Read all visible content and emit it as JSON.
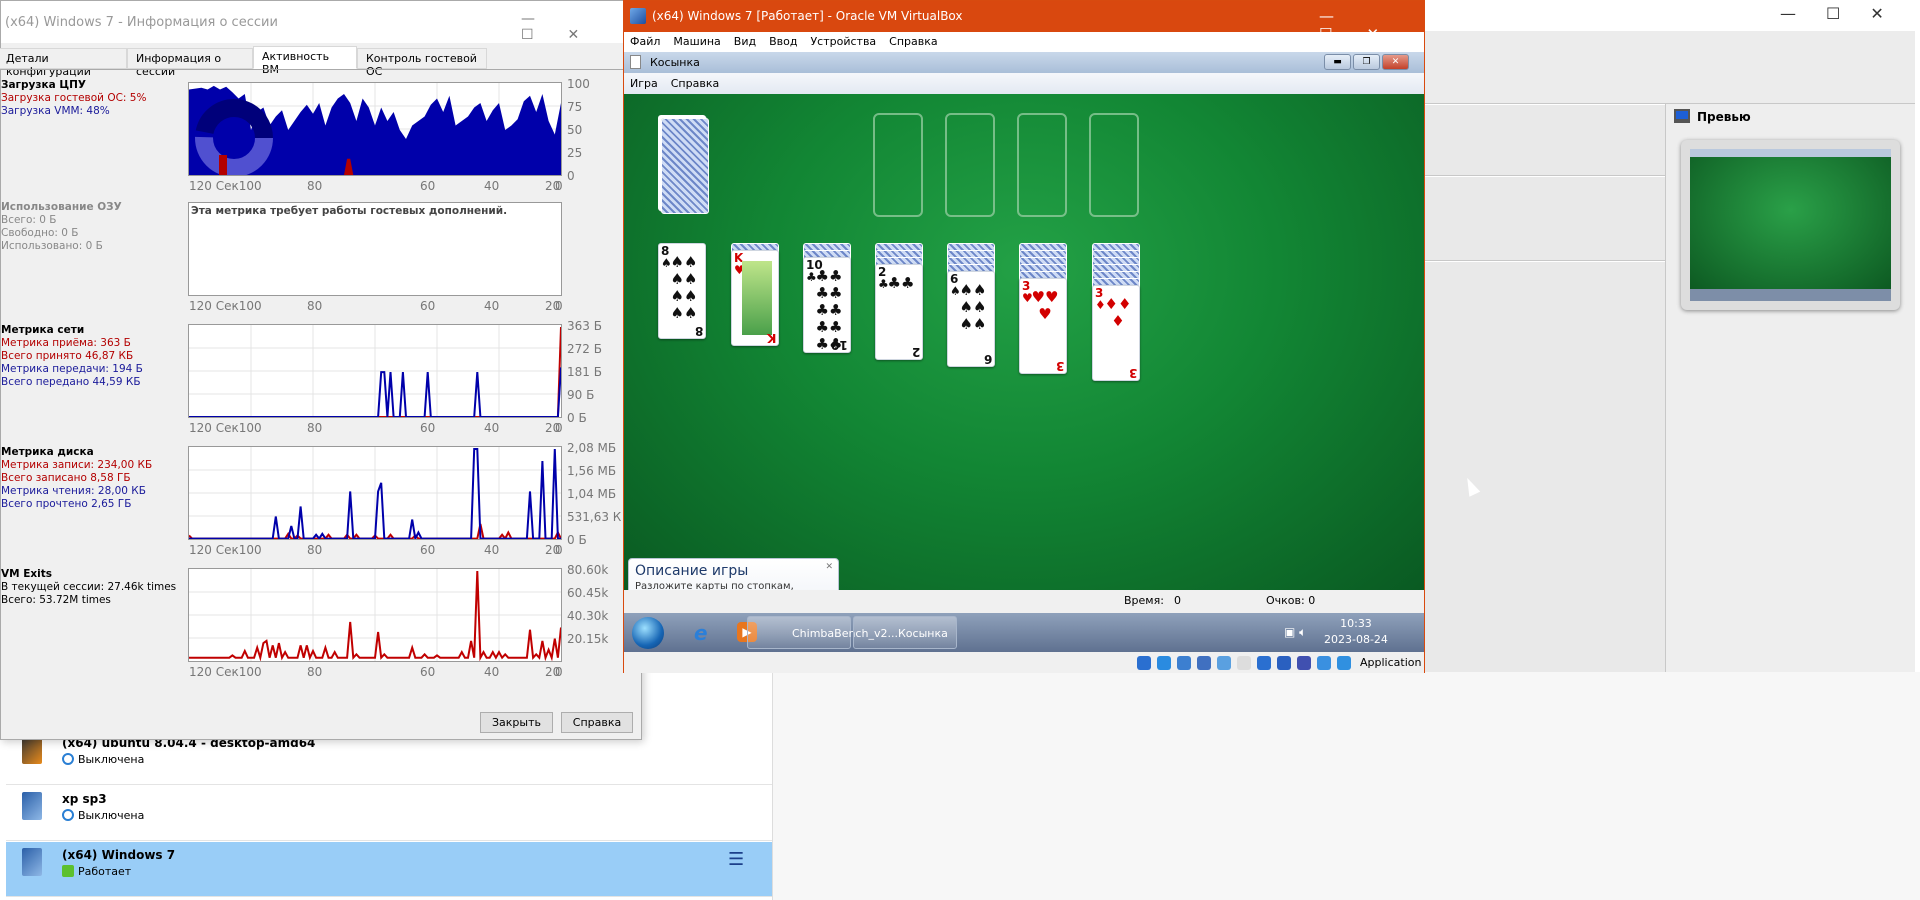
{
  "session_window": {
    "title": "(x64) Windows 7 - Информация о сессии",
    "tabs": [
      {
        "label": "Детали конфигурации",
        "active": false
      },
      {
        "label": "Информация о сессии",
        "active": false
      },
      {
        "label": "Активность ВМ",
        "active": true
      },
      {
        "label": "Контроль гостевой ОС",
        "active": false
      }
    ],
    "x_ticks": [
      "120 Сек100",
      "80",
      "60",
      "40",
      "20",
      "0"
    ],
    "cpu": {
      "title": "Загрузка ЦПУ",
      "guest": "Загрузка гостевой ОС: 5%",
      "vmm": "Загрузка VMM: 48%",
      "y_ticks": [
        "100",
        "75",
        "50",
        "25",
        "0"
      ],
      "ymax": 100,
      "vmm_series_every_2s_from_120": [
        95,
        96,
        97,
        95,
        99,
        95,
        98,
        92,
        85,
        90,
        50,
        70,
        75,
        55,
        65,
        72,
        50,
        60,
        70,
        78,
        68,
        80,
        55,
        75,
        85,
        90,
        80,
        60,
        85,
        75,
        55,
        75,
        60,
        70,
        50,
        40,
        55,
        60,
        65,
        78,
        85,
        70,
        88,
        55,
        60,
        65,
        75,
        80,
        60,
        72,
        80,
        50,
        55,
        62,
        82,
        88,
        70,
        90,
        60,
        45,
        80
      ],
      "guest_spikes": [
        [
          69,
          18
        ],
        [
          68,
          18
        ]
      ]
    },
    "ram": {
      "title": "Использование ОЗУ",
      "total": "Всего: 0 Б",
      "free": "Свободно: 0 Б",
      "used": "Использовано: 0 Б",
      "notice": "Эта метрика требует работы гостевых дополнений."
    },
    "net": {
      "title": "Метрика сети",
      "rx": "Метрика приёма: 363 Б",
      "rx_total": "Всего принято 46,87 КБ",
      "tx": "Метрика передачи: 194 Б",
      "tx_total": "Всего передано 44,59 КБ",
      "y_ticks": [
        "363 Б",
        "272 Б",
        "181 Б",
        "90 Б",
        "0 Б"
      ],
      "ymax": 363,
      "rx_spikes": [
        [
          0,
          363
        ]
      ],
      "tx_spikes": [
        [
          58,
          181
        ],
        [
          57,
          181
        ],
        [
          55,
          181
        ],
        [
          51,
          181
        ],
        [
          43,
          181
        ],
        [
          27,
          181
        ],
        [
          0,
          200
        ]
      ]
    },
    "disk": {
      "title": "Метрика диска",
      "write": "Метрика записи: 234,00 КБ",
      "write_total": "Всего записано 8,58 ГБ",
      "read": "Метрика чтения: 28,00 КБ",
      "read_total": "Всего прочтено 2,65 ГБ",
      "y_ticks": [
        "2,08 МБ",
        "1,56 МБ",
        "1,04 МБ",
        "531,63 К",
        "0 Б"
      ],
      "ymax": 2.08,
      "write_spikes": [
        [
          120,
          0.08
        ],
        [
          88,
          0.12
        ],
        [
          85,
          0.08
        ],
        [
          75,
          0.1
        ],
        [
          69,
          0.1
        ],
        [
          66,
          0.1
        ],
        [
          60,
          0.08
        ],
        [
          55,
          0.1
        ],
        [
          47,
          0.08
        ],
        [
          26,
          0.35
        ],
        [
          19,
          0.1
        ],
        [
          17,
          0.15
        ],
        [
          1,
          0.15
        ]
      ],
      "read_spikes": [
        [
          92,
          0.52
        ],
        [
          87,
          0.3
        ],
        [
          84,
          0.75
        ],
        [
          79,
          0.1
        ],
        [
          77,
          0.12
        ],
        [
          68,
          1.1
        ],
        [
          59,
          1.1
        ],
        [
          58,
          1.3
        ],
        [
          48,
          0.45
        ],
        [
          46,
          0.15
        ],
        [
          28,
          2.08
        ],
        [
          27,
          2.08
        ],
        [
          10,
          1.1
        ],
        [
          6,
          1.8
        ],
        [
          2,
          2.08
        ]
      ]
    },
    "vmexits": {
      "title": "VM Exits",
      "session": "В текущей сессии: 27.46k times",
      "total": "Всего: 53.72M times",
      "y_ticks": [
        "80.60k",
        "60.45k",
        "40.30k",
        "20.15k"
      ],
      "ymax": 80.6,
      "baseline": 3,
      "spikes": [
        [
          106,
          5
        ],
        [
          102,
          9
        ],
        [
          98,
          12
        ],
        [
          96,
          16
        ],
        [
          95,
          18
        ],
        [
          93,
          14
        ],
        [
          91,
          16
        ],
        [
          89,
          8
        ],
        [
          84,
          14
        ],
        [
          82,
          14
        ],
        [
          80,
          9
        ],
        [
          76,
          12
        ],
        [
          73,
          8
        ],
        [
          68,
          35
        ],
        [
          66,
          6
        ],
        [
          59,
          26
        ],
        [
          57,
          6
        ],
        [
          48,
          12
        ],
        [
          44,
          6
        ],
        [
          40,
          5
        ],
        [
          32,
          8
        ],
        [
          29,
          18
        ],
        [
          27,
          80.6
        ],
        [
          25,
          8
        ],
        [
          22,
          8
        ],
        [
          20,
          8
        ],
        [
          18,
          6
        ],
        [
          15,
          3
        ],
        [
          10,
          28
        ],
        [
          8,
          6
        ],
        [
          6,
          18
        ],
        [
          4,
          10
        ],
        [
          2,
          20
        ],
        [
          0,
          30
        ]
      ]
    },
    "buttons": {
      "close": "Закрыть",
      "help": "Справка"
    }
  },
  "virtualbox": {
    "title": "(x64) Windows 7 [Работает] - Oracle VM VirtualBox",
    "menu": [
      "Файл",
      "Машина",
      "Вид",
      "Ввод",
      "Устройства",
      "Справка"
    ],
    "status_label": "Application",
    "guest": {
      "window_title": "Косынка",
      "menu": [
        "Игра",
        "Справка"
      ],
      "tip_title": "Описание игры",
      "tip_text": "Разложите карты по стопкам, располагая их по порядку от самой сильной до самой слабой, чередуя красные и черные масти. Чтобы переместить карту, щелкните и перетащите ее.",
      "time_label": "Время:",
      "time_value": "0",
      "score_label": "Очков: 0",
      "taskbar": [
        {
          "label": "ChimbaBench_v2..."
        },
        {
          "label": "Косынка"
        }
      ],
      "clock_time": "10:33",
      "clock_date": "2023-08-24",
      "tableau": [
        {
          "backs": 0,
          "rank": "8",
          "suit": "♠",
          "color": "black"
        },
        {
          "backs": 1,
          "rank": "K",
          "suit": "♥",
          "color": "red"
        },
        {
          "backs": 2,
          "rank": "10",
          "suit": "♣",
          "color": "black"
        },
        {
          "backs": 3,
          "rank": "2",
          "suit": "♣",
          "color": "black"
        },
        {
          "backs": 4,
          "rank": "6",
          "suit": "♠",
          "color": "black"
        },
        {
          "backs": 5,
          "rank": "3",
          "suit": "♥",
          "color": "red"
        },
        {
          "backs": 6,
          "rank": "3",
          "suit": "♦",
          "color": "red"
        }
      ]
    }
  },
  "manager": {
    "preview_title": "Превью",
    "vms": [
      {
        "name": "(x64) ubuntu 8.04.4 - desktop-amd64",
        "state": "Выключена",
        "selected": false
      },
      {
        "name": "xp sp3",
        "state": "Выключена",
        "selected": false
      },
      {
        "name": "(x64) Windows 7",
        "state": "Работает",
        "selected": true
      }
    ]
  },
  "colors": {
    "vbox_title": "#d9480f",
    "selection": "#99cdf7",
    "series_red": "#b30000",
    "series_blue": "#0000aa"
  }
}
